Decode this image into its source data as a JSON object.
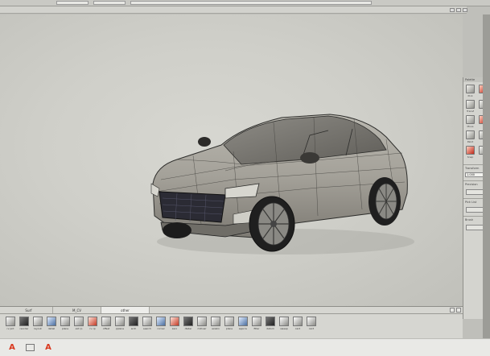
{
  "topbar": {
    "items": [
      "",
      "",
      ""
    ]
  },
  "window": {
    "title": ""
  },
  "shelf": {
    "tabs": [
      "Surf",
      "M_CV",
      "other"
    ],
    "active_tab": 2,
    "tools": [
      {
        "icon": "revolve-icon",
        "label": "rv pnt"
      },
      {
        "icon": "grid-icon",
        "label": "reorder"
      },
      {
        "icon": "layout-icon",
        "label": "layout"
      },
      {
        "icon": "detail-icon",
        "label": "detail"
      },
      {
        "icon": "plane-icon",
        "label": "plane"
      },
      {
        "icon": "curve-icon",
        "label": "ext rp"
      },
      {
        "icon": "curve-icon",
        "label": "rv cp"
      },
      {
        "icon": "offset-icon",
        "label": "offset"
      },
      {
        "icon": "plane-icon",
        "label": "pplane"
      },
      {
        "icon": "arc-icon",
        "label": "arch"
      },
      {
        "icon": "search-icon",
        "label": "search"
      },
      {
        "icon": "corner-icon",
        "label": "corner"
      },
      {
        "icon": "zero-icon",
        "label": "zero"
      },
      {
        "icon": "delete-icon",
        "label": "dleter"
      },
      {
        "icon": "modelview-icon",
        "label": "mdlvwr"
      },
      {
        "icon": "axis-icon",
        "label": "axialin"
      },
      {
        "icon": "plane-icon",
        "label": "plane"
      },
      {
        "icon": "approve-icon",
        "label": "approv"
      },
      {
        "icon": "filter-icon",
        "label": "filter"
      },
      {
        "icon": "datum-icon",
        "label": "datum"
      },
      {
        "icon": "sweep-icon",
        "label": "sweep"
      },
      {
        "icon": "card-icon",
        "label": "card"
      },
      {
        "icon": "card-icon",
        "label": "card"
      }
    ]
  },
  "palette": {
    "title": "Palette",
    "rows": [
      {
        "a": "Pick",
        "b": ""
      },
      {
        "a": "Transf",
        "b": ""
      },
      {
        "a": "Move",
        "b": ""
      },
      {
        "a": "Paint",
        "b": ""
      },
      {
        "a": "Snap",
        "b": ""
      },
      {
        "a": "Grid",
        "b": ""
      }
    ],
    "section_a": "Transform",
    "input_a": "1.000",
    "section_b": "Precision",
    "section_c": "Pick List",
    "section_d": "Brush"
  },
  "taskbar": {
    "app_icon": "autodesk-alias-icon",
    "app_glyph": "A"
  },
  "colors": {
    "accent": "#d9381e",
    "viewport": "#cfcfc9"
  }
}
